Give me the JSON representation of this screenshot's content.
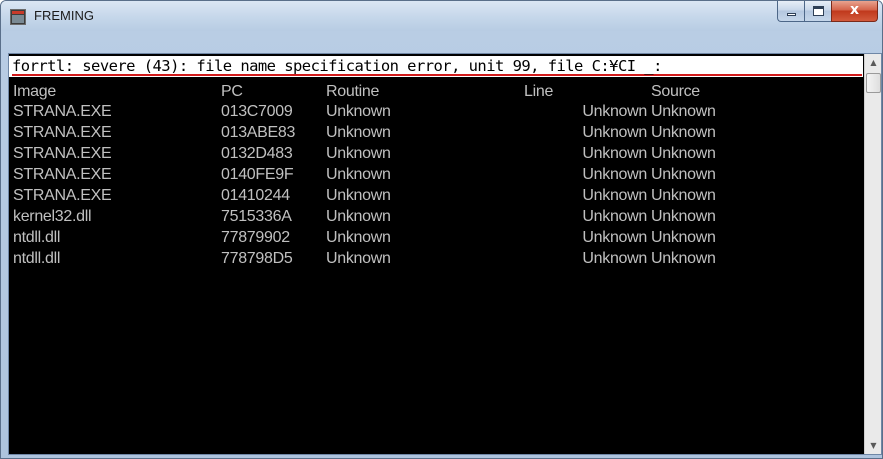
{
  "window": {
    "title": "FREMING",
    "close_symbol": "x"
  },
  "console": {
    "error_line": "forrtl: severe (43): file name specification error, unit 99, file C:¥CI _:",
    "headers": [
      "Image",
      "PC",
      "Routine",
      "Line",
      "Source"
    ],
    "rows": [
      [
        "STRANA.EXE",
        "013C7009",
        "Unknown",
        "Unknown",
        "Unknown"
      ],
      [
        "STRANA.EXE",
        "013ABE83",
        "Unknown",
        "Unknown",
        "Unknown"
      ],
      [
        "STRANA.EXE",
        "0132D483",
        "Unknown",
        "Unknown",
        "Unknown"
      ],
      [
        "STRANA.EXE",
        "0140FE9F",
        "Unknown",
        "Unknown",
        "Unknown"
      ],
      [
        "STRANA.EXE",
        "01410244",
        "Unknown",
        "Unknown",
        "Unknown"
      ],
      [
        "kernel32.dll",
        "7515336A",
        "Unknown",
        "Unknown",
        "Unknown"
      ],
      [
        "ntdll.dll",
        "77879902",
        "Unknown",
        "Unknown",
        "Unknown"
      ],
      [
        "ntdll.dll",
        "778798D5",
        "Unknown",
        "Unknown",
        "Unknown"
      ]
    ]
  },
  "scrollbar": {
    "up_arrow": "▲",
    "down_arrow": "▼"
  },
  "icons": {
    "app": "console-window-icon",
    "minimize": "minimize-icon",
    "maximize": "maximize-icon",
    "close": "close-icon"
  },
  "colors": {
    "console_bg": "#000000",
    "console_text": "#c0c0c0",
    "error_underline": "#d21a1a",
    "close_button": "#c0391c"
  }
}
